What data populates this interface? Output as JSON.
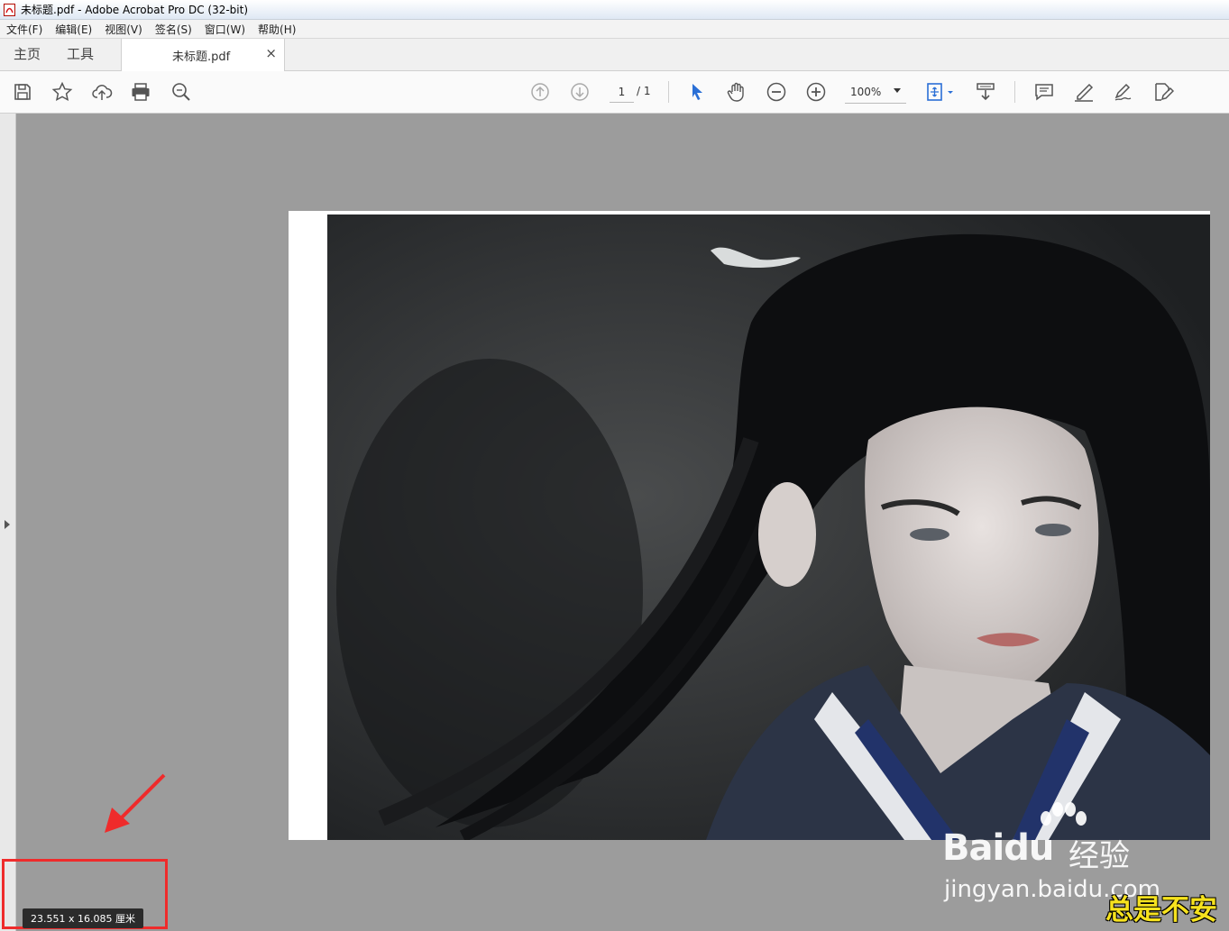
{
  "window": {
    "title": "未标题.pdf - Adobe Acrobat Pro DC (32-bit)",
    "app_icon": "acrobat-icon"
  },
  "menu": [
    "文件(F)",
    "编辑(E)",
    "视图(V)",
    "签名(S)",
    "窗口(W)",
    "帮助(H)"
  ],
  "tabs": {
    "home": "主页",
    "tools": "工具",
    "document": "未标题.pdf",
    "close_glyph": "×"
  },
  "toolbar": {
    "left_icons": [
      "save-icon",
      "star-icon",
      "upload-cloud-icon",
      "print-icon",
      "search-zoom-icon"
    ],
    "page_current": "1",
    "page_total": "/ 1",
    "zoom": "100%",
    "right_icons": [
      "select-pointer-icon",
      "hand-icon",
      "zoom-out-icon",
      "zoom-in-icon",
      "fit-page-icon",
      "scroll-mode-icon",
      "comment-icon",
      "highlight-pen-icon",
      "sign-icon",
      "edit-pdf-icon"
    ]
  },
  "status": {
    "page_dimensions": "23.551 x 16.085 厘米"
  },
  "watermark": {
    "brand": "Bai",
    "brand_suffix": "du",
    "cn": "经验",
    "url": "jingyan.baidu.com"
  },
  "overlay_caption": "总是不安",
  "colors": {
    "accent_blue": "#2a6fd6",
    "annotation_red": "#ef2b2b",
    "caption_yellow": "#f6e21e"
  }
}
